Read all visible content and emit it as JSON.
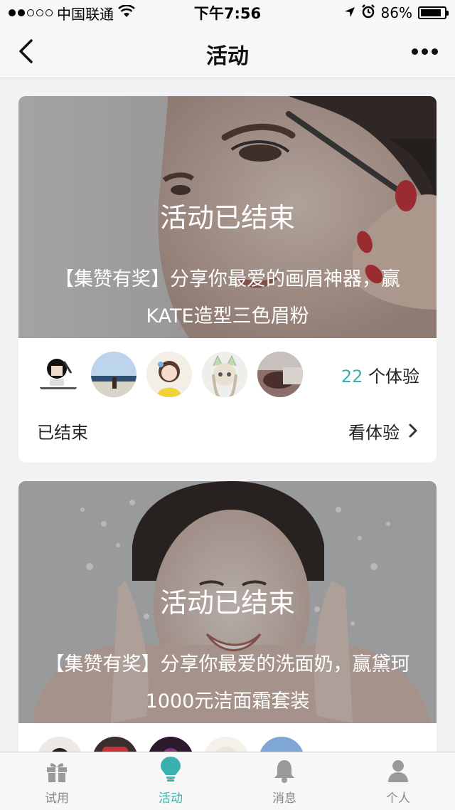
{
  "status_bar": {
    "carrier": "中国联通",
    "time": "下午7:56",
    "battery": "86%",
    "battery_level": 0.86
  },
  "nav": {
    "title": "活动"
  },
  "cards": [
    {
      "status_overlay": "活动已结束",
      "title": "【集赞有奖】分享你最爱的画眉神器，赢KATE造型三色眉粉",
      "participants_count": "22",
      "participants_suffix": " 个体验",
      "state": "已结束",
      "view_label": "看体验"
    },
    {
      "status_overlay": "活动已结束",
      "title": "【集赞有奖】分享你最爱的洗面奶，赢黛珂1000元洁面霜套装"
    }
  ],
  "tabs": [
    {
      "label": "试用",
      "icon": "gift-icon",
      "active": false
    },
    {
      "label": "活动",
      "icon": "lightbulb-icon",
      "active": true
    },
    {
      "label": "消息",
      "icon": "bell-icon",
      "active": false
    },
    {
      "label": "个人",
      "icon": "person-icon",
      "active": false
    }
  ],
  "colors": {
    "accent": "#3bb0b0",
    "inactive_tab": "#9a9a9a"
  }
}
